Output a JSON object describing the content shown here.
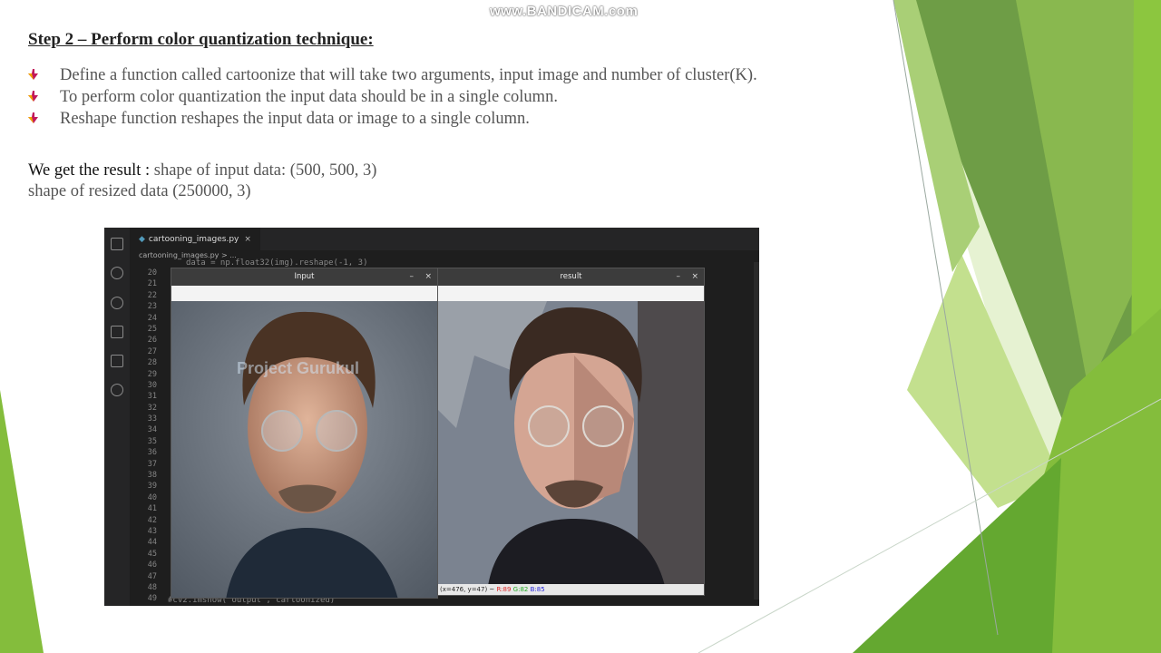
{
  "watermark": "www.BANDICAM.com",
  "slide": {
    "heading": "Step 2 – Perform color quantization technique:",
    "bullets": [
      "Define a function called cartoonize that will take two arguments, input image and number of cluster(K).",
      "To perform color quantization the input data should be in a single column.",
      "Reshape function reshapes the input data or image to a single column."
    ],
    "result_lead": "We get the result : ",
    "result_line1": "shape of input data: (500, 500, 3)",
    "result_line2": "shape of resized data (250000, 3)"
  },
  "ide": {
    "tab_label": "cartooning_images.py",
    "tab_close": "×",
    "breadcrumb": "cartooning_images.py > ...",
    "line_numbers": [
      "20",
      "21",
      "22",
      "23",
      "24",
      "25",
      "26",
      "27",
      "28",
      "29",
      "30",
      "31",
      "32",
      "33",
      "34",
      "35",
      "36",
      "37",
      "38",
      "39",
      "40",
      "41",
      "42",
      "43",
      "44",
      "45",
      "46",
      "47",
      "48",
      "49"
    ],
    "code_top": "data = np.float32(img).reshape(-1, 3)",
    "code_bottom": "#cv2.imshow('output', cartoonized)",
    "activity_icons": [
      "files-icon",
      "search-icon",
      "source-control-icon",
      "run-debug-icon",
      "extensions-icon",
      "github-icon"
    ]
  },
  "input_window": {
    "title": "Input",
    "minimize": "–",
    "close": "×",
    "overlay_text": "Project Gurukul"
  },
  "result_window": {
    "title": "result",
    "minimize": "–",
    "close": "×",
    "status_coords": "(x=476, y=47) ~ ",
    "status_r": "R:89",
    "status_g": "G:82",
    "status_b": "B:85"
  },
  "colors": {
    "green_dark": "#5f9a3a",
    "green_mid": "#84bd3c",
    "green_light": "#c3e08e",
    "ide_bg": "#1e1e1e",
    "bullet_icon": "#c2185b"
  }
}
